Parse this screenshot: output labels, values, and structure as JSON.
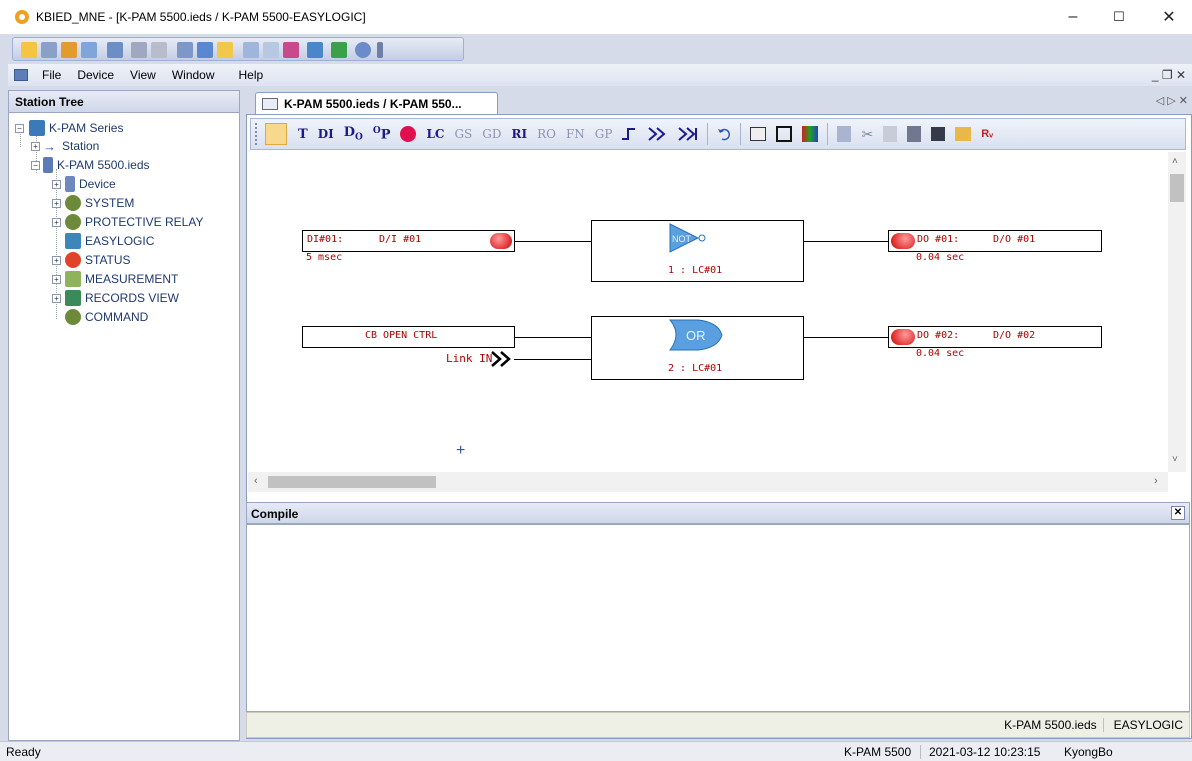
{
  "window": {
    "title": "KBIED_MNE - [K-PAM 5500.ieds / K-PAM 5500-EASYLOGIC]",
    "minimize": "–",
    "maximize": "☐",
    "close": "✕"
  },
  "menu": {
    "items": [
      "File",
      "Device",
      "View",
      "Window",
      "Help"
    ],
    "mdi_controls": "_ ❐ ✕"
  },
  "station_tree": {
    "header": "Station Tree",
    "items": [
      {
        "label": "K-PAM Series",
        "icon": "series-icon"
      },
      {
        "label": "Station",
        "icon": "arrow-icon"
      },
      {
        "label": "K-PAM 5500.ieds",
        "icon": "device-file-icon"
      },
      {
        "label": "Device",
        "icon": "device-icon"
      },
      {
        "label": "SYSTEM",
        "icon": "gears-icon"
      },
      {
        "label": "PROTECTIVE RELAY",
        "icon": "gears-icon"
      },
      {
        "label": "EASYLOGIC",
        "icon": "logic-icon"
      },
      {
        "label": "STATUS",
        "icon": "red-circle-icon"
      },
      {
        "label": "MEASUREMENT",
        "icon": "table-icon"
      },
      {
        "label": "RECORDS VIEW",
        "icon": "records-icon"
      },
      {
        "label": "COMMAND",
        "icon": "gears-icon"
      }
    ]
  },
  "document": {
    "tab_label": "K-PAM 5500.ieds / K-PAM 550...",
    "tab_controls": "◁ ▷ ✕",
    "tools": {
      "T": "T",
      "DI": "DI",
      "DO": "D",
      "DO_sub": "O",
      "OP": "O",
      "OP_sub": "P",
      "LC": "LC",
      "GS": "GS",
      "GD": "GD",
      "RI": "RI",
      "RO": "RO",
      "FN": "FN",
      "GP": "GP"
    }
  },
  "logic": {
    "row1": {
      "input_id": "DI#01:",
      "input_name": "D/I #01",
      "input_delay": "5 msec",
      "gate": "NOT",
      "lc_label": "1 : LC#01",
      "output_id": "DO #01:",
      "output_name": "D/O #01",
      "output_delay": "0.04 sec"
    },
    "row2": {
      "input_name": "CB OPEN CTRL",
      "link_label": "Link IN",
      "gate": "OR",
      "lc_label": "2 : LC#01",
      "output_id": "DO #02:",
      "output_name": "D/O #02",
      "output_delay": "0.04 sec"
    },
    "crosshair": "+"
  },
  "compile": {
    "header": "Compile",
    "close": "✕"
  },
  "doc_status": {
    "file": "K-PAM 5500.ieds",
    "view": "EASYLOGIC"
  },
  "statusbar": {
    "left": "Ready",
    "device": "K-PAM 5500",
    "datetime": "2021-03-12 10:23:15",
    "user": "KyongBo"
  },
  "colors": {
    "accent_red": "#b00000",
    "toolbar_blue": "#1a1a8c",
    "gate_blue": "#5aa0e0"
  }
}
